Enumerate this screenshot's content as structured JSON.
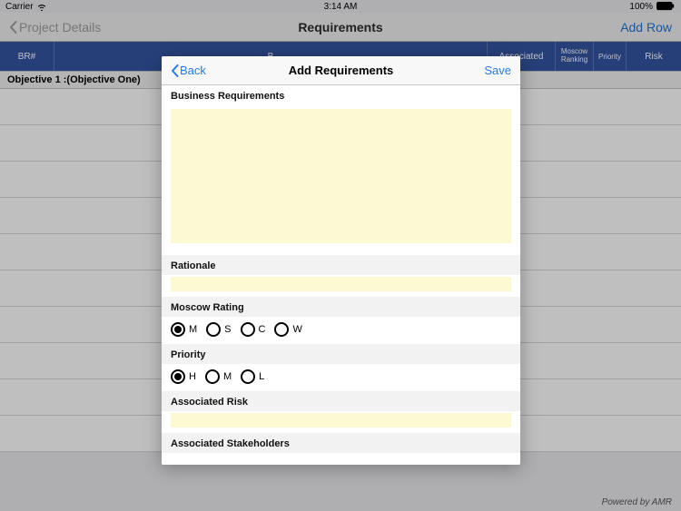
{
  "status": {
    "carrier": "Carrier",
    "time": "3:14 AM",
    "battery_pct": "100%"
  },
  "nav": {
    "back_label": "Project Details",
    "title": "Requirements",
    "action": "Add Row"
  },
  "table": {
    "columns": {
      "br": "BR#",
      "bname": "B",
      "assoc_stake": "Associated",
      "moscow": "Moscow Ranking",
      "priority": "Priority",
      "risk": "Risk"
    }
  },
  "section": {
    "title": "Objective 1 :(Objective One)"
  },
  "footer": "Powered by AMR",
  "modal": {
    "back": "Back",
    "title": "Add Requirements",
    "save": "Save",
    "fields": {
      "business_req": "Business Requirements",
      "rationale": "Rationale",
      "moscow": "Moscow Rating",
      "priority": "Priority",
      "assoc_risk": "Associated Risk",
      "assoc_stake": "Associated Stakeholders"
    },
    "values": {
      "business_req": "",
      "rationale": "",
      "assoc_risk": ""
    },
    "moscow_options": {
      "m": "M",
      "s": "S",
      "c": "C",
      "w": "W"
    },
    "moscow_selected": "m",
    "priority_options": {
      "h": "H",
      "m": "M",
      "l": "L"
    },
    "priority_selected": "h"
  }
}
